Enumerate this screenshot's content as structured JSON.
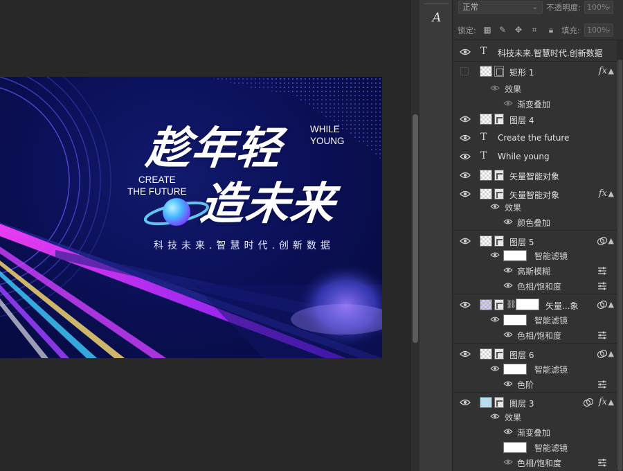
{
  "artwork": {
    "title_line1": "趁年轻",
    "title_line2": "造未来",
    "while_young": [
      "WHILE",
      "YOUNG"
    ],
    "create_future": [
      "CREATE",
      "THE FUTURE"
    ],
    "subtitle": "科技未来.智慧时代.创新数据"
  },
  "toolbar": {
    "char_tool_glyph": "A"
  },
  "panel": {
    "blend_mode": "正常",
    "opacity_label": "不透明度:",
    "opacity_value": "100%",
    "lock_label": "锁定:",
    "fill_label": "填充:",
    "fill_value": "100%"
  },
  "layers": [
    {
      "name": "科技未来.智慧时代.创新数据",
      "kind": "text",
      "visible": true
    },
    {
      "name": "矩形 1",
      "kind": "shape",
      "visible": false,
      "fx": true,
      "effects_label": "效果",
      "effects": [
        "渐变叠加"
      ]
    },
    {
      "name": "图层 4",
      "kind": "smart",
      "visible": true
    },
    {
      "name": "Create the future",
      "kind": "text",
      "visible": true
    },
    {
      "name": "While young",
      "kind": "text",
      "visible": true
    },
    {
      "name": "矢量智能对象",
      "kind": "smart",
      "visible": true
    },
    {
      "name": "矢量智能对象",
      "kind": "smart",
      "visible": true,
      "fx": true,
      "effects_label": "效果",
      "effects": [
        "颜色叠加"
      ]
    },
    {
      "name": "图层 5",
      "kind": "smart",
      "visible": true,
      "smart_filter": true,
      "filters_label": "智能滤镜",
      "filters": [
        "高斯模糊",
        "色相/饱和度"
      ]
    },
    {
      "name": "矢量...象",
      "kind": "smart-masked",
      "visible": true,
      "smart_filter": true,
      "filters_label": "智能滤镜",
      "filters": [
        "色相/饱和度"
      ]
    },
    {
      "name": "图层 6",
      "kind": "smart",
      "visible": true,
      "smart_filter": true,
      "filters_label": "智能滤镜",
      "filters": [
        "色阶"
      ]
    },
    {
      "name": "图层 3",
      "kind": "smart",
      "visible": true,
      "smart_filter": true,
      "fx": true,
      "effects_label": "效果",
      "effects": [
        "渐变叠加"
      ],
      "filters_label": "智能滤镜",
      "filters": [
        "色相/饱和度"
      ]
    }
  ],
  "colors": {
    "artboard_bg": "#0b1058",
    "accent_purple": "#c040ff",
    "panel_bg": "#323232",
    "canvas_bg": "#282828"
  }
}
